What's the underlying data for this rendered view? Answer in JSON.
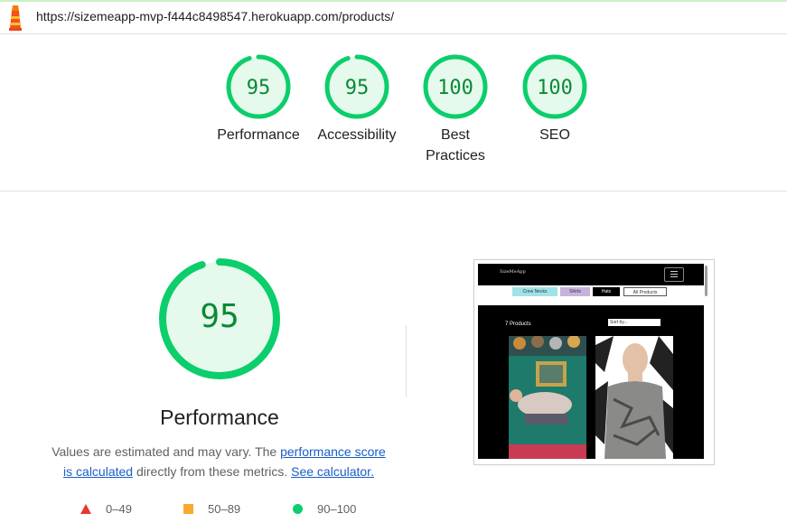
{
  "url": "https://sizemeapp-mvp-f444c8498547.herokuapp.com/products/",
  "summary": [
    {
      "score": "95",
      "label": "Performance",
      "fraction": 0.95
    },
    {
      "score": "95",
      "label": "Accessibility",
      "fraction": 0.95
    },
    {
      "score": "100",
      "label": "Best Practices",
      "fraction": 1.0
    },
    {
      "score": "100",
      "label": "SEO",
      "fraction": 1.0
    }
  ],
  "main": {
    "score": "95",
    "fraction": 0.95,
    "title": "Performance",
    "desc_text1": "Values are estimated and may vary. The ",
    "desc_link1": "performance score is calculated",
    "desc_text2": " directly from these metrics. ",
    "desc_link2": "See calculator."
  },
  "legend": {
    "fail": "0–49",
    "average": "50–89",
    "pass": "90–100"
  },
  "screenshot": {
    "brand": "SizeMeApp",
    "filters": [
      "Crew Necks",
      "Shirts",
      "Hats",
      "All Products"
    ],
    "count": "7 Products",
    "sort": "Sort by..."
  },
  "colors": {
    "pass": "#0cce6b",
    "pass_text": "#0a8a34",
    "pass_bg": "#e5f9ed",
    "average": "#fbaa2e",
    "fail": "#e53935",
    "link": "#1a5ec7"
  }
}
